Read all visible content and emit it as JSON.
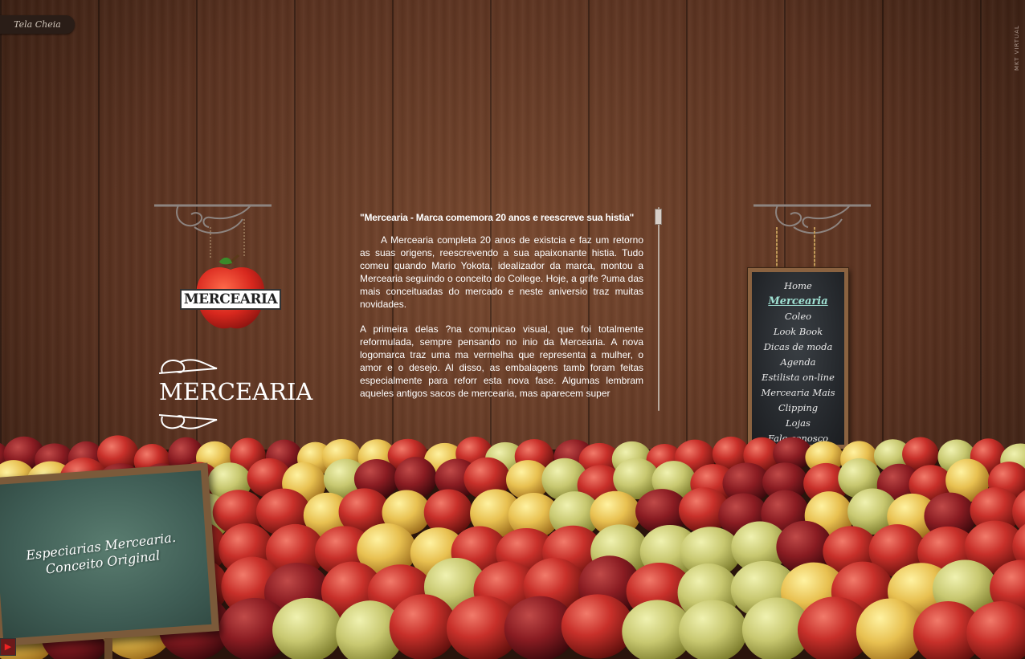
{
  "top_bar": {
    "fullscreen_label": "Tela Cheia"
  },
  "credit": {
    "text": "MKT VIRTUAL"
  },
  "logo": {
    "band_text": "MERCEARIA"
  },
  "wordmark": {
    "text": "MERCEARIA"
  },
  "article": {
    "title": "\"Mercearia - Marca comemora 20 anos e reescreve sua histia\"",
    "paragraphs": [
      "A Mercearia completa 20 anos de existcia e faz um retorno as suas origens, reescrevendo a sua apaixonante histia. Tudo comeu quando Mario Yokota, idealizador da marca, montou a Mercearia seguindo o conceito do College. Hoje, a grife ?uma das mais conceituadas do mercado e neste aniversio traz muitas novidades.",
      "A primeira delas ?na comunicao visual, que foi totalmente reformulada, sempre pensando no inio da Mercearia. A nova logomarca traz uma ma vermelha que representa a mulher, o amor e o desejo. Al disso, as embalagens tamb foram feitas especialmente para reforr esta nova fase. Algumas lembram aqueles antigos sacos de mercearia, mas aparecem super"
    ]
  },
  "menu": {
    "items": [
      {
        "label": "Home"
      },
      {
        "label": "Mercearia"
      },
      {
        "label": "Coleo"
      },
      {
        "label": "Look Book"
      },
      {
        "label": "Dicas de moda"
      },
      {
        "label": "Agenda"
      },
      {
        "label": "Estilista on-line"
      },
      {
        "label": "Mercearia Mais"
      },
      {
        "label": "Clipping"
      },
      {
        "label": "Lojas"
      },
      {
        "label": "Fale conosco"
      }
    ],
    "active_index": 1
  },
  "easel": {
    "line1": "Especiarias Mercearia.",
    "line2": "Conceito Original"
  },
  "colors": {
    "apple_red": "#c8302a",
    "menu_active": "#9fe0d2",
    "chalkboard": "#24272b"
  }
}
